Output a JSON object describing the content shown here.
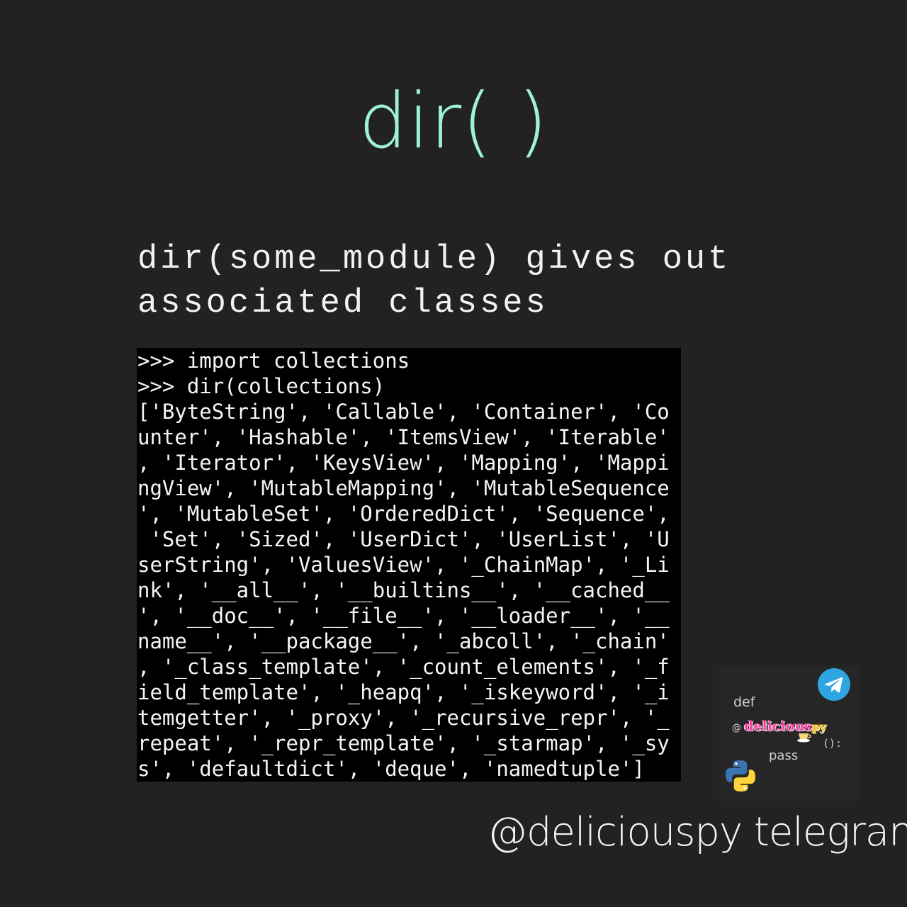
{
  "title": "dir( )",
  "subtitle": {
    "line1": "dir(some_module) gives out",
    "line2": "associated classes"
  },
  "terminal": {
    "lines": [
      ">>> import collections",
      ">>> dir(collections)",
      "['ByteString', 'Callable', 'Container', 'Co",
      "unter', 'Hashable', 'ItemsView', 'Iterable'",
      ", 'Iterator', 'KeysView', 'Mapping', 'Mappi",
      "ngView', 'MutableMapping', 'MutableSequence",
      "', 'MutableSet', 'OrderedDict', 'Sequence',",
      " 'Set', 'Sized', 'UserDict', 'UserList', 'U",
      "serString', 'ValuesView', '_ChainMap', '_Li",
      "nk', '__all__', '__builtins__', '__cached__",
      "', '__doc__', '__file__', '__loader__', '__",
      "name__', '__package__', '_abcoll', '_chain'",
      ", '_class_template', '_count_elements', '_f",
      "ield_template', '_heapq', '_iskeyword', '_i",
      "temgetter', '_proxy', '_recursive_repr', '_",
      "repeat', '_repr_template', '_starmap', '_sy",
      "s', 'defaultdict', 'deque', 'namedtuple']"
    ]
  },
  "logo": {
    "def": "def",
    "at": "@",
    "handle": "delicious",
    "handle_suffix": "py",
    "paren": "():",
    "pass": "pass",
    "icons": [
      "telegram-icon",
      "python-icon",
      "coffee-cup-icon"
    ]
  },
  "footer": "@deliciouspy telegram",
  "colors": {
    "background": "#222222",
    "title": "#9ef3d3",
    "terminal_bg": "#000000",
    "terminal_text": "#f5f5f5",
    "telegram": "#2ca5e0",
    "handle": "#ff3fa2"
  }
}
